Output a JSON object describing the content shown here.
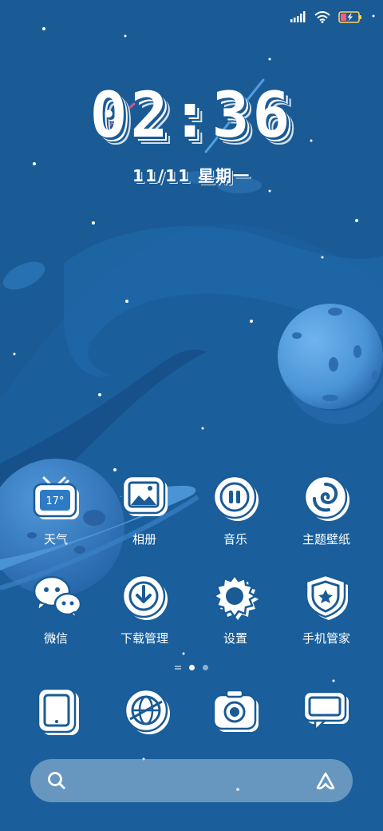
{
  "status_bar": {
    "signal_icon": "signal-bars-icon",
    "wifi_icon": "wifi-icon",
    "battery_icon": "battery-charging-icon"
  },
  "lockscreen_clock": {
    "time": "02:36",
    "date": "11/11 星期一"
  },
  "apps": [
    {
      "id": "weather",
      "label": "天气",
      "icon": "weather-tv-icon",
      "icon_text": "17°"
    },
    {
      "id": "gallery",
      "label": "相册",
      "icon": "gallery-icon"
    },
    {
      "id": "music",
      "label": "音乐",
      "icon": "music-icon"
    },
    {
      "id": "themes",
      "label": "主题壁纸",
      "icon": "themes-icon"
    },
    {
      "id": "wechat",
      "label": "微信",
      "icon": "wechat-icon"
    },
    {
      "id": "downloads",
      "label": "下载管理",
      "icon": "download-icon"
    },
    {
      "id": "settings",
      "label": "设置",
      "icon": "gear-icon"
    },
    {
      "id": "security",
      "label": "手机管家",
      "icon": "shield-icon"
    }
  ],
  "page_indicator": {
    "pages": 3,
    "current": 2
  },
  "dock": [
    {
      "id": "phone",
      "icon": "phone-icon"
    },
    {
      "id": "browser",
      "icon": "browser-icon"
    },
    {
      "id": "camera",
      "icon": "camera-icon"
    },
    {
      "id": "messages",
      "icon": "message-icon"
    }
  ],
  "search_bar": {
    "search_icon": "search-icon",
    "assistant_icon": "assistant-icon"
  },
  "colors": {
    "background": "#1a5b95",
    "planet_light": "#58a6e6",
    "planet_dark": "#2b6fb5",
    "icon_white": "#ffffff",
    "icon_shadow": "#1a5b95"
  }
}
